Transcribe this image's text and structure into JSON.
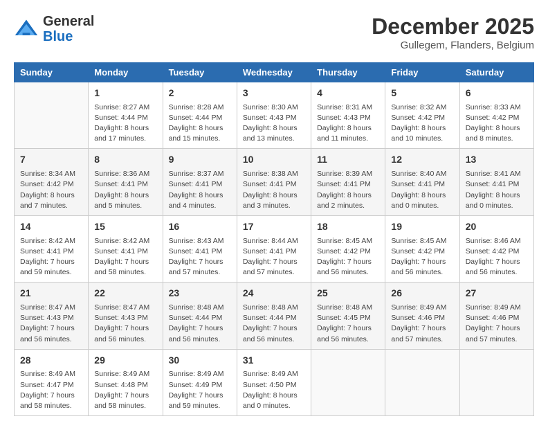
{
  "header": {
    "logo_line1": "General",
    "logo_line2": "Blue",
    "month_title": "December 2025",
    "location": "Gullegem, Flanders, Belgium"
  },
  "days_of_week": [
    "Sunday",
    "Monday",
    "Tuesday",
    "Wednesday",
    "Thursday",
    "Friday",
    "Saturday"
  ],
  "weeks": [
    [
      {
        "day": "",
        "info": ""
      },
      {
        "day": "1",
        "info": "Sunrise: 8:27 AM\nSunset: 4:44 PM\nDaylight: 8 hours\nand 17 minutes."
      },
      {
        "day": "2",
        "info": "Sunrise: 8:28 AM\nSunset: 4:44 PM\nDaylight: 8 hours\nand 15 minutes."
      },
      {
        "day": "3",
        "info": "Sunrise: 8:30 AM\nSunset: 4:43 PM\nDaylight: 8 hours\nand 13 minutes."
      },
      {
        "day": "4",
        "info": "Sunrise: 8:31 AM\nSunset: 4:43 PM\nDaylight: 8 hours\nand 11 minutes."
      },
      {
        "day": "5",
        "info": "Sunrise: 8:32 AM\nSunset: 4:42 PM\nDaylight: 8 hours\nand 10 minutes."
      },
      {
        "day": "6",
        "info": "Sunrise: 8:33 AM\nSunset: 4:42 PM\nDaylight: 8 hours\nand 8 minutes."
      }
    ],
    [
      {
        "day": "7",
        "info": "Sunrise: 8:34 AM\nSunset: 4:42 PM\nDaylight: 8 hours\nand 7 minutes."
      },
      {
        "day": "8",
        "info": "Sunrise: 8:36 AM\nSunset: 4:41 PM\nDaylight: 8 hours\nand 5 minutes."
      },
      {
        "day": "9",
        "info": "Sunrise: 8:37 AM\nSunset: 4:41 PM\nDaylight: 8 hours\nand 4 minutes."
      },
      {
        "day": "10",
        "info": "Sunrise: 8:38 AM\nSunset: 4:41 PM\nDaylight: 8 hours\nand 3 minutes."
      },
      {
        "day": "11",
        "info": "Sunrise: 8:39 AM\nSunset: 4:41 PM\nDaylight: 8 hours\nand 2 minutes."
      },
      {
        "day": "12",
        "info": "Sunrise: 8:40 AM\nSunset: 4:41 PM\nDaylight: 8 hours\nand 0 minutes."
      },
      {
        "day": "13",
        "info": "Sunrise: 8:41 AM\nSunset: 4:41 PM\nDaylight: 8 hours\nand 0 minutes."
      }
    ],
    [
      {
        "day": "14",
        "info": "Sunrise: 8:42 AM\nSunset: 4:41 PM\nDaylight: 7 hours\nand 59 minutes."
      },
      {
        "day": "15",
        "info": "Sunrise: 8:42 AM\nSunset: 4:41 PM\nDaylight: 7 hours\nand 58 minutes."
      },
      {
        "day": "16",
        "info": "Sunrise: 8:43 AM\nSunset: 4:41 PM\nDaylight: 7 hours\nand 57 minutes."
      },
      {
        "day": "17",
        "info": "Sunrise: 8:44 AM\nSunset: 4:41 PM\nDaylight: 7 hours\nand 57 minutes."
      },
      {
        "day": "18",
        "info": "Sunrise: 8:45 AM\nSunset: 4:42 PM\nDaylight: 7 hours\nand 56 minutes."
      },
      {
        "day": "19",
        "info": "Sunrise: 8:45 AM\nSunset: 4:42 PM\nDaylight: 7 hours\nand 56 minutes."
      },
      {
        "day": "20",
        "info": "Sunrise: 8:46 AM\nSunset: 4:42 PM\nDaylight: 7 hours\nand 56 minutes."
      }
    ],
    [
      {
        "day": "21",
        "info": "Sunrise: 8:47 AM\nSunset: 4:43 PM\nDaylight: 7 hours\nand 56 minutes."
      },
      {
        "day": "22",
        "info": "Sunrise: 8:47 AM\nSunset: 4:43 PM\nDaylight: 7 hours\nand 56 minutes."
      },
      {
        "day": "23",
        "info": "Sunrise: 8:48 AM\nSunset: 4:44 PM\nDaylight: 7 hours\nand 56 minutes."
      },
      {
        "day": "24",
        "info": "Sunrise: 8:48 AM\nSunset: 4:44 PM\nDaylight: 7 hours\nand 56 minutes."
      },
      {
        "day": "25",
        "info": "Sunrise: 8:48 AM\nSunset: 4:45 PM\nDaylight: 7 hours\nand 56 minutes."
      },
      {
        "day": "26",
        "info": "Sunrise: 8:49 AM\nSunset: 4:46 PM\nDaylight: 7 hours\nand 57 minutes."
      },
      {
        "day": "27",
        "info": "Sunrise: 8:49 AM\nSunset: 4:46 PM\nDaylight: 7 hours\nand 57 minutes."
      }
    ],
    [
      {
        "day": "28",
        "info": "Sunrise: 8:49 AM\nSunset: 4:47 PM\nDaylight: 7 hours\nand 58 minutes."
      },
      {
        "day": "29",
        "info": "Sunrise: 8:49 AM\nSunset: 4:48 PM\nDaylight: 7 hours\nand 58 minutes."
      },
      {
        "day": "30",
        "info": "Sunrise: 8:49 AM\nSunset: 4:49 PM\nDaylight: 7 hours\nand 59 minutes."
      },
      {
        "day": "31",
        "info": "Sunrise: 8:49 AM\nSunset: 4:50 PM\nDaylight: 8 hours\nand 0 minutes."
      },
      {
        "day": "",
        "info": ""
      },
      {
        "day": "",
        "info": ""
      },
      {
        "day": "",
        "info": ""
      }
    ]
  ]
}
